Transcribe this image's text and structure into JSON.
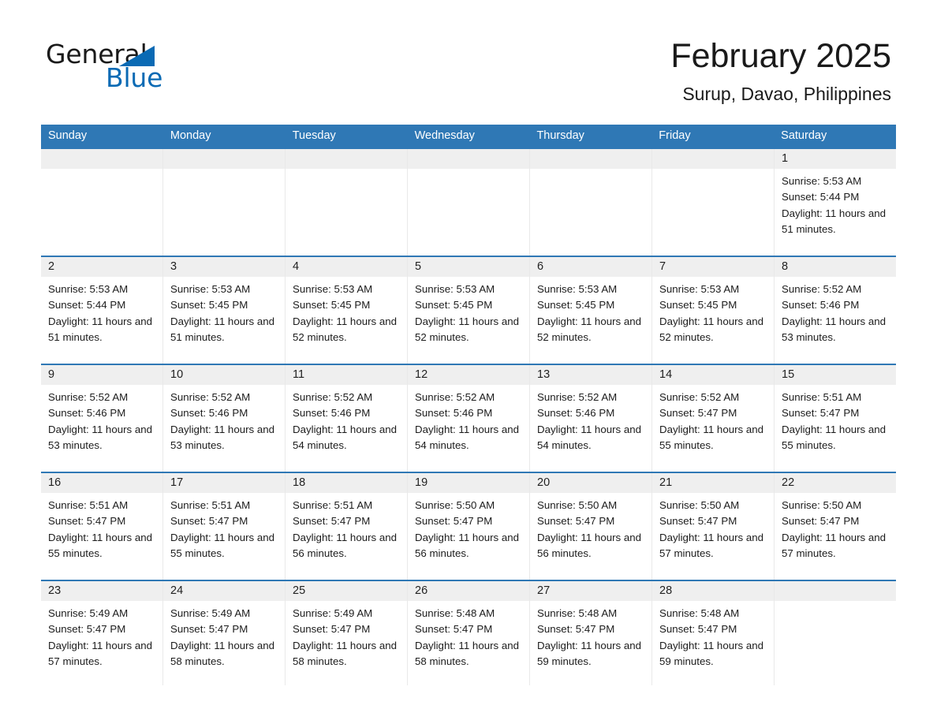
{
  "brand": {
    "name_part1": "General",
    "name_part2": "Blue",
    "accent_color": "#0a6ab4"
  },
  "header": {
    "title": "February 2025",
    "location": "Surup, Davao, Philippines"
  },
  "theme": {
    "header_blue": "#2f78b5",
    "date_band_gray": "#efefef",
    "grid_line": "#e9e9e9"
  },
  "weekdays": [
    "Sunday",
    "Monday",
    "Tuesday",
    "Wednesday",
    "Thursday",
    "Friday",
    "Saturday"
  ],
  "weeks": [
    [
      {
        "day": "",
        "empty": true
      },
      {
        "day": "",
        "empty": true
      },
      {
        "day": "",
        "empty": true
      },
      {
        "day": "",
        "empty": true
      },
      {
        "day": "",
        "empty": true
      },
      {
        "day": "",
        "empty": true
      },
      {
        "day": "1",
        "sunrise": "Sunrise: 5:53 AM",
        "sunset": "Sunset: 5:44 PM",
        "daylight": "Daylight: 11 hours and 51 minutes."
      }
    ],
    [
      {
        "day": "2",
        "sunrise": "Sunrise: 5:53 AM",
        "sunset": "Sunset: 5:44 PM",
        "daylight": "Daylight: 11 hours and 51 minutes."
      },
      {
        "day": "3",
        "sunrise": "Sunrise: 5:53 AM",
        "sunset": "Sunset: 5:45 PM",
        "daylight": "Daylight: 11 hours and 51 minutes."
      },
      {
        "day": "4",
        "sunrise": "Sunrise: 5:53 AM",
        "sunset": "Sunset: 5:45 PM",
        "daylight": "Daylight: 11 hours and 52 minutes."
      },
      {
        "day": "5",
        "sunrise": "Sunrise: 5:53 AM",
        "sunset": "Sunset: 5:45 PM",
        "daylight": "Daylight: 11 hours and 52 minutes."
      },
      {
        "day": "6",
        "sunrise": "Sunrise: 5:53 AM",
        "sunset": "Sunset: 5:45 PM",
        "daylight": "Daylight: 11 hours and 52 minutes."
      },
      {
        "day": "7",
        "sunrise": "Sunrise: 5:53 AM",
        "sunset": "Sunset: 5:45 PM",
        "daylight": "Daylight: 11 hours and 52 minutes."
      },
      {
        "day": "8",
        "sunrise": "Sunrise: 5:52 AM",
        "sunset": "Sunset: 5:46 PM",
        "daylight": "Daylight: 11 hours and 53 minutes."
      }
    ],
    [
      {
        "day": "9",
        "sunrise": "Sunrise: 5:52 AM",
        "sunset": "Sunset: 5:46 PM",
        "daylight": "Daylight: 11 hours and 53 minutes."
      },
      {
        "day": "10",
        "sunrise": "Sunrise: 5:52 AM",
        "sunset": "Sunset: 5:46 PM",
        "daylight": "Daylight: 11 hours and 53 minutes."
      },
      {
        "day": "11",
        "sunrise": "Sunrise: 5:52 AM",
        "sunset": "Sunset: 5:46 PM",
        "daylight": "Daylight: 11 hours and 54 minutes."
      },
      {
        "day": "12",
        "sunrise": "Sunrise: 5:52 AM",
        "sunset": "Sunset: 5:46 PM",
        "daylight": "Daylight: 11 hours and 54 minutes."
      },
      {
        "day": "13",
        "sunrise": "Sunrise: 5:52 AM",
        "sunset": "Sunset: 5:46 PM",
        "daylight": "Daylight: 11 hours and 54 minutes."
      },
      {
        "day": "14",
        "sunrise": "Sunrise: 5:52 AM",
        "sunset": "Sunset: 5:47 PM",
        "daylight": "Daylight: 11 hours and 55 minutes."
      },
      {
        "day": "15",
        "sunrise": "Sunrise: 5:51 AM",
        "sunset": "Sunset: 5:47 PM",
        "daylight": "Daylight: 11 hours and 55 minutes."
      }
    ],
    [
      {
        "day": "16",
        "sunrise": "Sunrise: 5:51 AM",
        "sunset": "Sunset: 5:47 PM",
        "daylight": "Daylight: 11 hours and 55 minutes."
      },
      {
        "day": "17",
        "sunrise": "Sunrise: 5:51 AM",
        "sunset": "Sunset: 5:47 PM",
        "daylight": "Daylight: 11 hours and 55 minutes."
      },
      {
        "day": "18",
        "sunrise": "Sunrise: 5:51 AM",
        "sunset": "Sunset: 5:47 PM",
        "daylight": "Daylight: 11 hours and 56 minutes."
      },
      {
        "day": "19",
        "sunrise": "Sunrise: 5:50 AM",
        "sunset": "Sunset: 5:47 PM",
        "daylight": "Daylight: 11 hours and 56 minutes."
      },
      {
        "day": "20",
        "sunrise": "Sunrise: 5:50 AM",
        "sunset": "Sunset: 5:47 PM",
        "daylight": "Daylight: 11 hours and 56 minutes."
      },
      {
        "day": "21",
        "sunrise": "Sunrise: 5:50 AM",
        "sunset": "Sunset: 5:47 PM",
        "daylight": "Daylight: 11 hours and 57 minutes."
      },
      {
        "day": "22",
        "sunrise": "Sunrise: 5:50 AM",
        "sunset": "Sunset: 5:47 PM",
        "daylight": "Daylight: 11 hours and 57 minutes."
      }
    ],
    [
      {
        "day": "23",
        "sunrise": "Sunrise: 5:49 AM",
        "sunset": "Sunset: 5:47 PM",
        "daylight": "Daylight: 11 hours and 57 minutes."
      },
      {
        "day": "24",
        "sunrise": "Sunrise: 5:49 AM",
        "sunset": "Sunset: 5:47 PM",
        "daylight": "Daylight: 11 hours and 58 minutes."
      },
      {
        "day": "25",
        "sunrise": "Sunrise: 5:49 AM",
        "sunset": "Sunset: 5:47 PM",
        "daylight": "Daylight: 11 hours and 58 minutes."
      },
      {
        "day": "26",
        "sunrise": "Sunrise: 5:48 AM",
        "sunset": "Sunset: 5:47 PM",
        "daylight": "Daylight: 11 hours and 58 minutes."
      },
      {
        "day": "27",
        "sunrise": "Sunrise: 5:48 AM",
        "sunset": "Sunset: 5:47 PM",
        "daylight": "Daylight: 11 hours and 59 minutes."
      },
      {
        "day": "28",
        "sunrise": "Sunrise: 5:48 AM",
        "sunset": "Sunset: 5:47 PM",
        "daylight": "Daylight: 11 hours and 59 minutes."
      },
      {
        "day": "",
        "empty": true
      }
    ]
  ]
}
